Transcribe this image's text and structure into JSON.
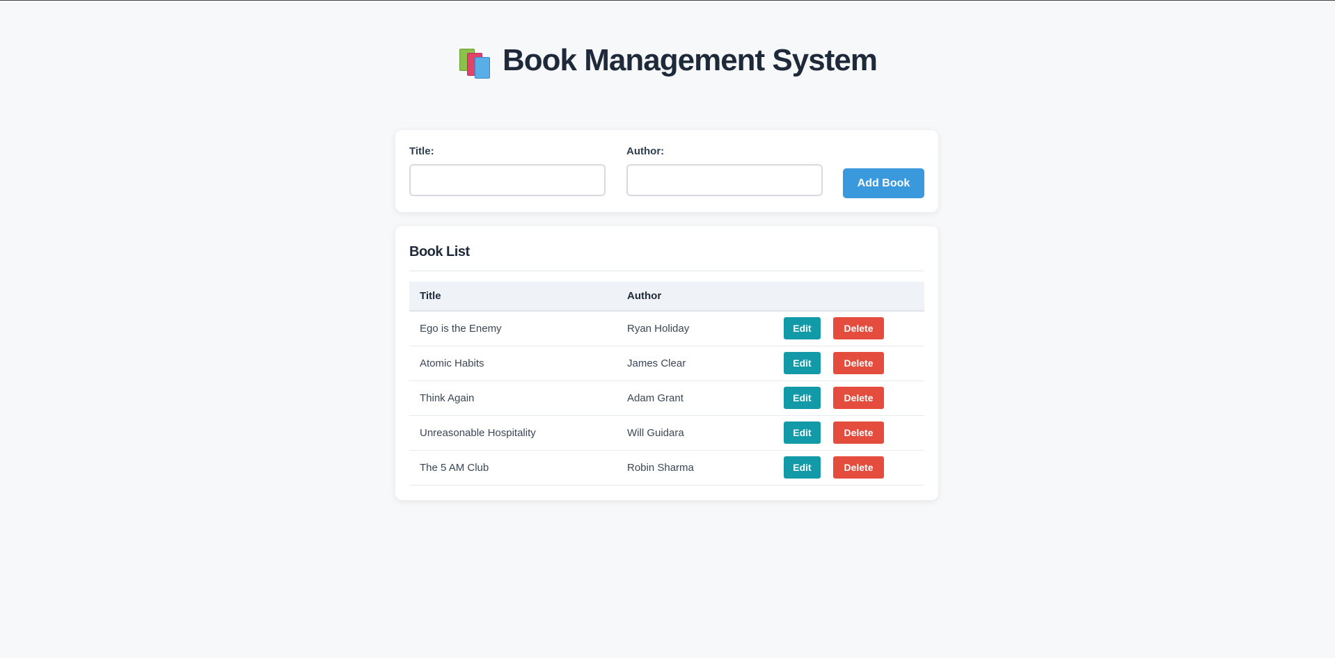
{
  "header": {
    "icon": "books-icon",
    "title": "Book Management System"
  },
  "form": {
    "title_label": "Title:",
    "title_value": "",
    "author_label": "Author:",
    "author_value": "",
    "add_button": "Add Book"
  },
  "book_list": {
    "heading": "Book List",
    "columns": [
      "Title",
      "Author"
    ],
    "rows": [
      {
        "title": "Ego is the Enemy",
        "author": "Ryan Holiday"
      },
      {
        "title": "Atomic Habits",
        "author": "James Clear"
      },
      {
        "title": "Think Again",
        "author": "Adam Grant"
      },
      {
        "title": "Unreasonable Hospitality",
        "author": "Will Guidara"
      },
      {
        "title": "The 5 AM Club",
        "author": "Robin Sharma"
      }
    ],
    "edit_label": "Edit",
    "delete_label": "Delete"
  },
  "colors": {
    "accent": "#3a98dc",
    "edit": "#129aa8",
    "delete": "#e44d3d",
    "heading": "#1e2a3a"
  }
}
